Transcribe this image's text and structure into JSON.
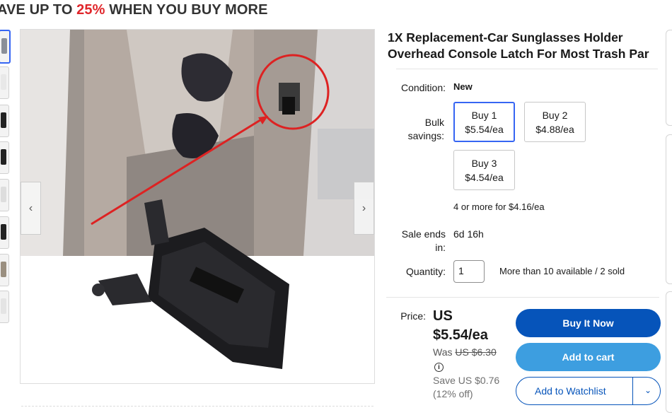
{
  "promo": {
    "prefix": "AVE UP TO",
    "percent": "25%",
    "suffix": "WHEN YOU BUY MORE"
  },
  "product": {
    "title": "1X Replacement-Car Sunglasses Holder Overhead Console Latch For Most Trash Par",
    "condition_label": "Condition:",
    "condition_value": "New",
    "bulk_label_1": "Bulk",
    "bulk_label_2": "savings:",
    "bulk_options": [
      {
        "qty": "Buy 1",
        "price": "$5.54/ea"
      },
      {
        "qty": "Buy 2",
        "price": "$4.88/ea"
      },
      {
        "qty": "Buy 3",
        "price": "$4.54/ea"
      }
    ],
    "bulk_more": "4 or more for $4.16/ea",
    "sale_ends_label_1": "Sale ends",
    "sale_ends_label_2": "in:",
    "sale_ends_value": "6d 16h",
    "quantity_label": "Quantity:",
    "quantity_value": "1",
    "availability": "More than 10 available / 2 sold"
  },
  "price": {
    "label": "Price:",
    "currency": "US",
    "amount": "$5.54/ea",
    "was_label": "Was",
    "was_amount": "US $6.30",
    "info_icon_glyph": "i",
    "save_line_1": "Save US $0.76",
    "save_line_2": "(12% off)"
  },
  "actions": {
    "buy_now": "Buy It Now",
    "add_to_cart": "Add to cart",
    "add_to_watchlist": "Add to Watchlist",
    "watchlist_caret": "⌄"
  },
  "gallery": {
    "prev_glyph": "‹",
    "next_glyph": "›"
  },
  "icons": {
    "info": "info-circle-icon",
    "prev": "chevron-left-icon",
    "next": "chevron-right-icon",
    "caret": "chevron-down-icon"
  },
  "colors": {
    "promo_accent": "#e0262b",
    "buy_now": "#0654ba",
    "add_to_cart": "#3d9ee0",
    "selected_option_border": "#3665f3"
  }
}
